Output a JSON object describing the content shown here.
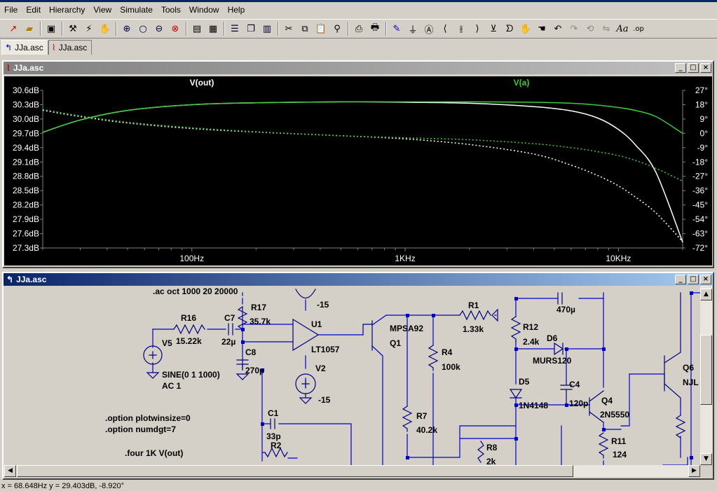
{
  "menu": [
    "File",
    "Edit",
    "Hierarchy",
    "View",
    "Simulate",
    "Tools",
    "Window",
    "Help"
  ],
  "toolbar_icons": [
    "new-schematic",
    "open-folder",
    "save",
    "control-panel",
    "run",
    "halt",
    "zoom-in",
    "pan",
    "zoom-out",
    "zoom-cancel",
    "autorange",
    "grid",
    "tile-horizontal",
    "cascade",
    "tile-vertical",
    "cut",
    "copy",
    "paste",
    "find",
    "print-setup",
    "print",
    "draw-wire",
    "ground",
    "label-net",
    "resistor",
    "capacitor",
    "inductor",
    "diode",
    "component",
    "move",
    "drag",
    "undo",
    "redo",
    "rotate",
    "mirror",
    "text",
    "spice-directive"
  ],
  "tabs": [
    {
      "label": "JJa.asc",
      "icon": "schematic-icon",
      "active": true
    },
    {
      "label": "JJa.asc",
      "icon": "waveform-icon",
      "active": false
    }
  ],
  "plot_window": {
    "title": "JJa.asc"
  },
  "schematic_window": {
    "title": "JJa.asc"
  },
  "chart_data": {
    "type": "line",
    "x_scale": "log",
    "xlim": [
      20,
      20000
    ],
    "x_ticks": [
      {
        "value": 100,
        "label": "100Hz"
      },
      {
        "value": 1000,
        "label": "1KHz"
      },
      {
        "value": 10000,
        "label": "10KHz"
      }
    ],
    "y_left_ticks": [
      "30.6dB",
      "30.3dB",
      "30.0dB",
      "29.7dB",
      "29.4dB",
      "29.1dB",
      "28.8dB",
      "28.5dB",
      "28.2dB",
      "27.9dB",
      "27.6dB",
      "27.3dB"
    ],
    "y_right_ticks": [
      "27°",
      "18°",
      "9°",
      "0°",
      "-9°",
      "-18°",
      "-27°",
      "-36°",
      "-45°",
      "-54°",
      "-63°",
      "-72°"
    ],
    "ylim_left": [
      27.3,
      30.6
    ],
    "ylim_right": [
      -72,
      27
    ],
    "series": [
      {
        "name": "V(out)",
        "color": "#ffffff",
        "magnitude": {
          "x": [
            20,
            30,
            50,
            100,
            200,
            500,
            1000,
            2000,
            4000,
            6000,
            8000,
            10000,
            12000,
            15000,
            20000
          ],
          "y": [
            29.72,
            29.98,
            30.18,
            30.3,
            30.34,
            30.36,
            30.35,
            30.33,
            30.26,
            30.17,
            30.02,
            29.78,
            29.46,
            28.88,
            27.42
          ]
        },
        "phase": {
          "x": [
            20,
            30,
            50,
            100,
            200,
            500,
            1000,
            2000,
            4000,
            6000,
            8000,
            10000,
            12000,
            15000,
            20000
          ],
          "y": [
            14.5,
            10.5,
            6.5,
            3,
            0.8,
            -1.5,
            -3.5,
            -7,
            -13,
            -20,
            -26.5,
            -33,
            -40,
            -50,
            -68
          ]
        }
      },
      {
        "name": "V(a)",
        "color": "#3ec83e",
        "magnitude": {
          "x": [
            20,
            30,
            50,
            100,
            200,
            500,
            1000,
            2000,
            4000,
            6000,
            8000,
            10000,
            12000,
            15000,
            20000
          ],
          "y": [
            29.72,
            29.98,
            30.18,
            30.3,
            30.34,
            30.36,
            30.36,
            30.36,
            30.35,
            30.33,
            30.29,
            30.24,
            30.18,
            30.05,
            29.7
          ]
        },
        "phase": {
          "x": [
            20,
            30,
            50,
            100,
            200,
            500,
            1000,
            2000,
            4000,
            6000,
            8000,
            10000,
            12000,
            15000,
            20000
          ],
          "y": [
            15,
            11,
            7,
            3.5,
            1,
            -1.5,
            -2.8,
            -4,
            -6.5,
            -9,
            -11.5,
            -14,
            -17,
            -22,
            -30
          ]
        }
      }
    ]
  },
  "schematic": {
    "directives": [
      ".ac oct 1000 20 20000",
      ".option plotwinsize=0",
      ".option numdgt=7",
      ".four 1K V(out)"
    ],
    "labels": [
      {
        "id": "r16",
        "text": "R16"
      },
      {
        "id": "r16v",
        "text": "15.22k"
      },
      {
        "id": "c7",
        "text": "C7"
      },
      {
        "id": "c7v",
        "text": "22µ"
      },
      {
        "id": "r17",
        "text": "R17"
      },
      {
        "id": "r17v",
        "text": "35.7k"
      },
      {
        "id": "c8",
        "text": "C8"
      },
      {
        "id": "c8v",
        "text": "270p"
      },
      {
        "id": "v5",
        "text": "V5"
      },
      {
        "id": "v5v",
        "text": "SINE(0 1 1000)"
      },
      {
        "id": "v5ac",
        "text": "AC 1"
      },
      {
        "id": "m15a",
        "text": "-15"
      },
      {
        "id": "u1",
        "text": "U1"
      },
      {
        "id": "u1v",
        "text": "LT1057"
      },
      {
        "id": "v2",
        "text": "V2"
      },
      {
        "id": "m15b",
        "text": "-15"
      },
      {
        "id": "c1",
        "text": "C1"
      },
      {
        "id": "c1v",
        "text": "33p"
      },
      {
        "id": "r2",
        "text": "R2"
      },
      {
        "id": "mpsa",
        "text": "MPSA92"
      },
      {
        "id": "q1",
        "text": "Q1"
      },
      {
        "id": "r1",
        "text": "R1"
      },
      {
        "id": "r1v",
        "text": "1.33k"
      },
      {
        "id": "r4",
        "text": "R4"
      },
      {
        "id": "r4v",
        "text": "100k"
      },
      {
        "id": "r7",
        "text": "R7"
      },
      {
        "id": "r7v",
        "text": "40.2k"
      },
      {
        "id": "r8",
        "text": "R8"
      },
      {
        "id": "r8v",
        "text": "2k"
      },
      {
        "id": "c5v",
        "text": "470µ"
      },
      {
        "id": "r12",
        "text": "R12"
      },
      {
        "id": "r12v",
        "text": "2.4k"
      },
      {
        "id": "d6",
        "text": "D6"
      },
      {
        "id": "d6v",
        "text": "MURS120"
      },
      {
        "id": "d5",
        "text": "D5"
      },
      {
        "id": "d5v",
        "text": "1N4148"
      },
      {
        "id": "c4",
        "text": "C4"
      },
      {
        "id": "c4v",
        "text": "120p"
      },
      {
        "id": "q4",
        "text": "Q4"
      },
      {
        "id": "q4v",
        "text": "2N5550"
      },
      {
        "id": "r11",
        "text": "R11"
      },
      {
        "id": "r11v",
        "text": "124"
      },
      {
        "id": "q6",
        "text": "Q6"
      },
      {
        "id": "q6v",
        "text": "NJL"
      }
    ]
  },
  "status": "x = 68.648Hz    y = 29.403dB, -8.920°"
}
